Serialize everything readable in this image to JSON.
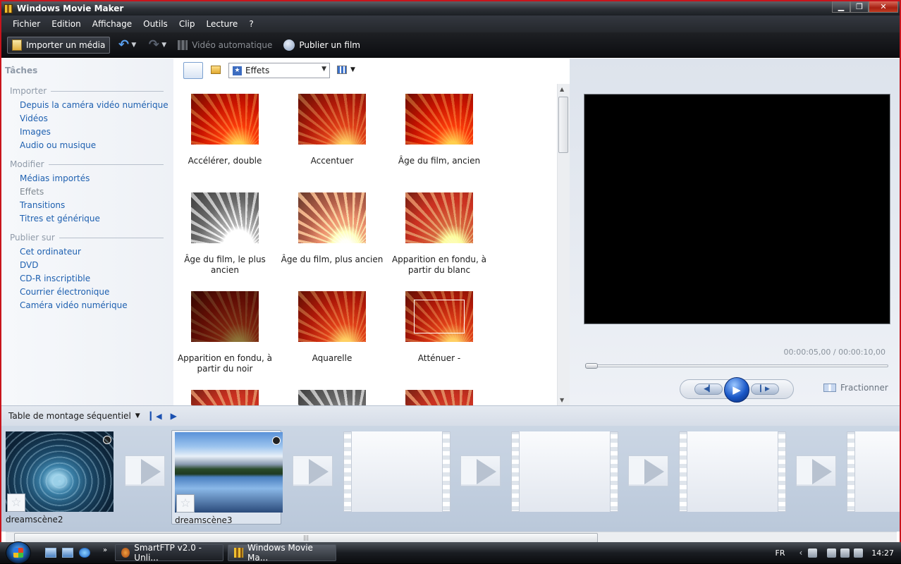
{
  "window": {
    "title": "Windows Movie Maker"
  },
  "menu": [
    "Fichier",
    "Edition",
    "Affichage",
    "Outils",
    "Clip",
    "Lecture",
    "?"
  ],
  "toolbar": {
    "import": "Importer un média",
    "auto_movie": "Vidéo automatique",
    "publish": "Publier un film"
  },
  "tasks": {
    "title": "Tâches",
    "groups": [
      {
        "label": "Importer",
        "items": [
          "Depuis la caméra vidéo numérique",
          "Vidéos",
          "Images",
          "Audio ou musique"
        ]
      },
      {
        "label": "Modifier",
        "items": [
          "Médias importés",
          "Effets",
          "Transitions",
          "Titres et générique"
        ]
      },
      {
        "label": "Publier sur",
        "items": [
          "Cet ordinateur",
          "DVD",
          "CD-R inscriptible",
          "Courrier électronique",
          "Caméra vidéo numérique"
        ]
      }
    ]
  },
  "collection": {
    "selected": "Effets"
  },
  "effects": [
    {
      "name": "Accélérer, double"
    },
    {
      "name": "Accentuer"
    },
    {
      "name": "Âge du film, ancien"
    },
    {
      "name": "Âge du film, le plus ancien"
    },
    {
      "name": "Âge du film, plus ancien"
    },
    {
      "name": "Apparition en fondu, à partir du blanc"
    },
    {
      "name": "Apparition en fondu, à partir du noir"
    },
    {
      "name": "Aquarelle"
    },
    {
      "name": "Atténuer -"
    }
  ],
  "preview": {
    "time": "00:00:05,00 / 00:00:10,00",
    "split": "Fractionner"
  },
  "storyboard": {
    "label": "Table de montage séquentiel",
    "clips": [
      {
        "name": "dreamscène2"
      },
      {
        "name": "dreamscène3"
      }
    ]
  },
  "taskbar": {
    "tasks": [
      {
        "label": "SmartFTP v2.0 - Unli..."
      },
      {
        "label": "Windows Movie Ma..."
      }
    ],
    "lang": "FR",
    "clock": "14:27"
  }
}
